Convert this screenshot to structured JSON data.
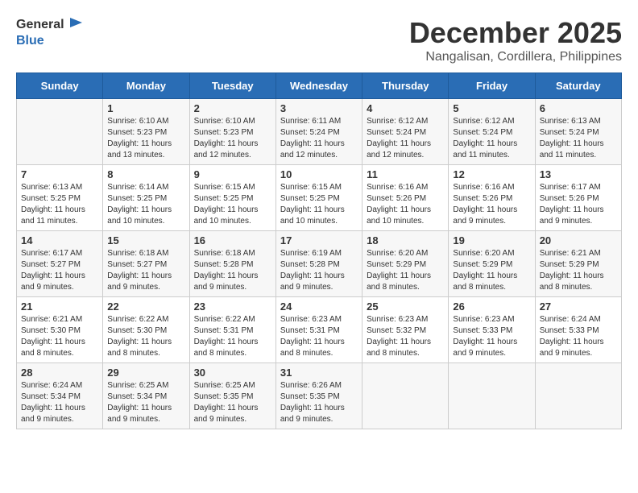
{
  "header": {
    "logo_general": "General",
    "logo_blue": "Blue",
    "month_title": "December 2025",
    "location": "Nangalisan, Cordillera, Philippines"
  },
  "weekdays": [
    "Sunday",
    "Monday",
    "Tuesday",
    "Wednesday",
    "Thursday",
    "Friday",
    "Saturday"
  ],
  "weeks": [
    [
      {
        "day": "",
        "info": ""
      },
      {
        "day": "1",
        "info": "Sunrise: 6:10 AM\nSunset: 5:23 PM\nDaylight: 11 hours\nand 13 minutes."
      },
      {
        "day": "2",
        "info": "Sunrise: 6:10 AM\nSunset: 5:23 PM\nDaylight: 11 hours\nand 12 minutes."
      },
      {
        "day": "3",
        "info": "Sunrise: 6:11 AM\nSunset: 5:24 PM\nDaylight: 11 hours\nand 12 minutes."
      },
      {
        "day": "4",
        "info": "Sunrise: 6:12 AM\nSunset: 5:24 PM\nDaylight: 11 hours\nand 12 minutes."
      },
      {
        "day": "5",
        "info": "Sunrise: 6:12 AM\nSunset: 5:24 PM\nDaylight: 11 hours\nand 11 minutes."
      },
      {
        "day": "6",
        "info": "Sunrise: 6:13 AM\nSunset: 5:24 PM\nDaylight: 11 hours\nand 11 minutes."
      }
    ],
    [
      {
        "day": "7",
        "info": "Sunrise: 6:13 AM\nSunset: 5:25 PM\nDaylight: 11 hours\nand 11 minutes."
      },
      {
        "day": "8",
        "info": "Sunrise: 6:14 AM\nSunset: 5:25 PM\nDaylight: 11 hours\nand 10 minutes."
      },
      {
        "day": "9",
        "info": "Sunrise: 6:15 AM\nSunset: 5:25 PM\nDaylight: 11 hours\nand 10 minutes."
      },
      {
        "day": "10",
        "info": "Sunrise: 6:15 AM\nSunset: 5:25 PM\nDaylight: 11 hours\nand 10 minutes."
      },
      {
        "day": "11",
        "info": "Sunrise: 6:16 AM\nSunset: 5:26 PM\nDaylight: 11 hours\nand 10 minutes."
      },
      {
        "day": "12",
        "info": "Sunrise: 6:16 AM\nSunset: 5:26 PM\nDaylight: 11 hours\nand 9 minutes."
      },
      {
        "day": "13",
        "info": "Sunrise: 6:17 AM\nSunset: 5:26 PM\nDaylight: 11 hours\nand 9 minutes."
      }
    ],
    [
      {
        "day": "14",
        "info": "Sunrise: 6:17 AM\nSunset: 5:27 PM\nDaylight: 11 hours\nand 9 minutes."
      },
      {
        "day": "15",
        "info": "Sunrise: 6:18 AM\nSunset: 5:27 PM\nDaylight: 11 hours\nand 9 minutes."
      },
      {
        "day": "16",
        "info": "Sunrise: 6:18 AM\nSunset: 5:28 PM\nDaylight: 11 hours\nand 9 minutes."
      },
      {
        "day": "17",
        "info": "Sunrise: 6:19 AM\nSunset: 5:28 PM\nDaylight: 11 hours\nand 9 minutes."
      },
      {
        "day": "18",
        "info": "Sunrise: 6:20 AM\nSunset: 5:29 PM\nDaylight: 11 hours\nand 8 minutes."
      },
      {
        "day": "19",
        "info": "Sunrise: 6:20 AM\nSunset: 5:29 PM\nDaylight: 11 hours\nand 8 minutes."
      },
      {
        "day": "20",
        "info": "Sunrise: 6:21 AM\nSunset: 5:29 PM\nDaylight: 11 hours\nand 8 minutes."
      }
    ],
    [
      {
        "day": "21",
        "info": "Sunrise: 6:21 AM\nSunset: 5:30 PM\nDaylight: 11 hours\nand 8 minutes."
      },
      {
        "day": "22",
        "info": "Sunrise: 6:22 AM\nSunset: 5:30 PM\nDaylight: 11 hours\nand 8 minutes."
      },
      {
        "day": "23",
        "info": "Sunrise: 6:22 AM\nSunset: 5:31 PM\nDaylight: 11 hours\nand 8 minutes."
      },
      {
        "day": "24",
        "info": "Sunrise: 6:23 AM\nSunset: 5:31 PM\nDaylight: 11 hours\nand 8 minutes."
      },
      {
        "day": "25",
        "info": "Sunrise: 6:23 AM\nSunset: 5:32 PM\nDaylight: 11 hours\nand 8 minutes."
      },
      {
        "day": "26",
        "info": "Sunrise: 6:23 AM\nSunset: 5:33 PM\nDaylight: 11 hours\nand 9 minutes."
      },
      {
        "day": "27",
        "info": "Sunrise: 6:24 AM\nSunset: 5:33 PM\nDaylight: 11 hours\nand 9 minutes."
      }
    ],
    [
      {
        "day": "28",
        "info": "Sunrise: 6:24 AM\nSunset: 5:34 PM\nDaylight: 11 hours\nand 9 minutes."
      },
      {
        "day": "29",
        "info": "Sunrise: 6:25 AM\nSunset: 5:34 PM\nDaylight: 11 hours\nand 9 minutes."
      },
      {
        "day": "30",
        "info": "Sunrise: 6:25 AM\nSunset: 5:35 PM\nDaylight: 11 hours\nand 9 minutes."
      },
      {
        "day": "31",
        "info": "Sunrise: 6:26 AM\nSunset: 5:35 PM\nDaylight: 11 hours\nand 9 minutes."
      },
      {
        "day": "",
        "info": ""
      },
      {
        "day": "",
        "info": ""
      },
      {
        "day": "",
        "info": ""
      }
    ]
  ]
}
